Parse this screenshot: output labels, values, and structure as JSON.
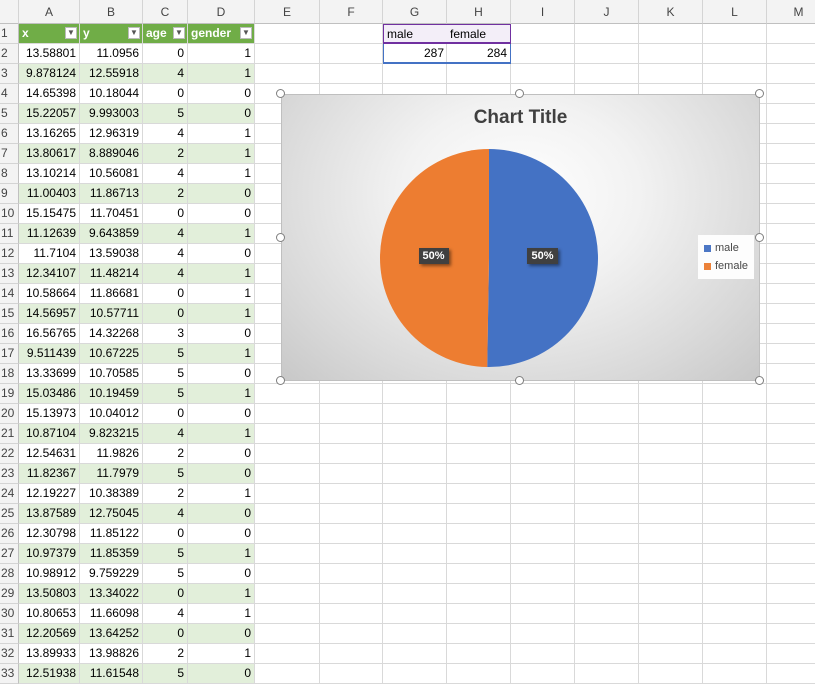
{
  "columns": [
    "A",
    "B",
    "C",
    "D",
    "E",
    "F",
    "G",
    "H",
    "I",
    "J",
    "K",
    "L",
    "M"
  ],
  "table": {
    "headers": [
      "x",
      "y",
      "age",
      "gender"
    ],
    "rows": [
      [
        "13.58801",
        "11.0956",
        "0",
        "1"
      ],
      [
        "9.878124",
        "12.55918",
        "4",
        "1"
      ],
      [
        "14.65398",
        "10.18044",
        "0",
        "0"
      ],
      [
        "15.22057",
        "9.993003",
        "5",
        "0"
      ],
      [
        "13.16265",
        "12.96319",
        "4",
        "1"
      ],
      [
        "13.80617",
        "8.889046",
        "2",
        "1"
      ],
      [
        "13.10214",
        "10.56081",
        "4",
        "1"
      ],
      [
        "11.00403",
        "11.86713",
        "2",
        "0"
      ],
      [
        "15.15475",
        "11.70451",
        "0",
        "0"
      ],
      [
        "11.12639",
        "9.643859",
        "4",
        "1"
      ],
      [
        "11.7104",
        "13.59038",
        "4",
        "0"
      ],
      [
        "12.34107",
        "11.48214",
        "4",
        "1"
      ],
      [
        "10.58664",
        "11.86681",
        "0",
        "1"
      ],
      [
        "14.56957",
        "10.57711",
        "0",
        "1"
      ],
      [
        "16.56765",
        "14.32268",
        "3",
        "0"
      ],
      [
        "9.511439",
        "10.67225",
        "5",
        "1"
      ],
      [
        "13.33699",
        "10.70585",
        "5",
        "0"
      ],
      [
        "15.03486",
        "10.19459",
        "5",
        "1"
      ],
      [
        "15.13973",
        "10.04012",
        "0",
        "0"
      ],
      [
        "10.87104",
        "9.823215",
        "4",
        "1"
      ],
      [
        "12.54631",
        "11.9826",
        "2",
        "0"
      ],
      [
        "11.82367",
        "11.7979",
        "5",
        "0"
      ],
      [
        "12.19227",
        "10.38389",
        "2",
        "1"
      ],
      [
        "13.87589",
        "12.75045",
        "4",
        "0"
      ],
      [
        "12.30798",
        "11.85122",
        "0",
        "0"
      ],
      [
        "10.97379",
        "11.85359",
        "5",
        "1"
      ],
      [
        "10.98912",
        "9.759229",
        "5",
        "0"
      ],
      [
        "13.50803",
        "13.34022",
        "0",
        "1"
      ],
      [
        "10.80653",
        "11.66098",
        "4",
        "1"
      ],
      [
        "12.20569",
        "13.64252",
        "0",
        "0"
      ],
      [
        "13.89933",
        "13.98826",
        "2",
        "1"
      ],
      [
        "12.51938",
        "11.61548",
        "5",
        "0"
      ]
    ]
  },
  "summary": {
    "labels": [
      "male",
      "female"
    ],
    "values": [
      "287",
      "284"
    ]
  },
  "chart_data": {
    "type": "pie",
    "title": "Chart Title",
    "categories": [
      "male",
      "female"
    ],
    "values": [
      287,
      284
    ],
    "data_labels": [
      "50%",
      "50%"
    ],
    "colors": [
      "#4472c4",
      "#ed7d31"
    ],
    "legend": "right"
  },
  "icons": {
    "filter_dropdown": "chevron-down-icon"
  }
}
